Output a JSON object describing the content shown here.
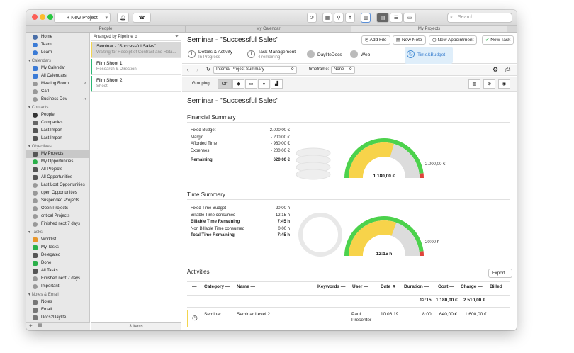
{
  "toolbar": {
    "new_project_label": "+ New Project",
    "search_placeholder": "Search"
  },
  "tabs": [
    "People",
    "My Calendar",
    "My Projects"
  ],
  "sidebar": {
    "top_items": [
      {
        "label": "Home",
        "icon": "home-icon"
      },
      {
        "label": "Team",
        "icon": "team-icon"
      },
      {
        "label": "Learn",
        "icon": "learn-icon"
      }
    ],
    "calendars_title": "Calendars",
    "calendars": [
      {
        "label": "My Calendar",
        "icon": "calendar-icon"
      },
      {
        "label": "All Calendars",
        "icon": "calendar-icon"
      },
      {
        "label": "Meeting Room",
        "icon": "resource-icon"
      },
      {
        "label": "Carl",
        "icon": "resource-icon"
      },
      {
        "label": "Business Dev",
        "icon": "resource-icon"
      }
    ],
    "contacts_title": "Contacts",
    "contacts": [
      {
        "label": "People",
        "icon": "person-icon"
      },
      {
        "label": "Companies",
        "icon": "building-icon"
      },
      {
        "label": "Last Import",
        "icon": "import-icon"
      },
      {
        "label": "Last Import",
        "icon": "import-icon"
      }
    ],
    "objectives_title": "Objectives",
    "objectives": [
      {
        "label": "My Projects",
        "icon": "project-icon"
      },
      {
        "label": "My Opportunities",
        "icon": "opportunity-icon"
      },
      {
        "label": "All Projects",
        "icon": "project-icon"
      },
      {
        "label": "All Opportunities",
        "icon": "opportunity-icon"
      },
      {
        "label": "Last Lost Opportunities",
        "icon": "filter-icon"
      },
      {
        "label": "open Opportunities",
        "icon": "filter-icon"
      },
      {
        "label": "Suspended Projects",
        "icon": "filter-icon"
      },
      {
        "label": "Open Projects",
        "icon": "filter-icon"
      },
      {
        "label": "critical Projects",
        "icon": "filter-icon"
      },
      {
        "label": "Finished next 7 days",
        "icon": "filter-icon"
      }
    ],
    "tasks_title": "Tasks",
    "tasks": [
      {
        "label": "Worklist",
        "icon": "worklist-icon"
      },
      {
        "label": "My Tasks",
        "icon": "check-icon"
      },
      {
        "label": "Delegated",
        "icon": "delegate-icon"
      },
      {
        "label": "Done",
        "icon": "done-icon"
      },
      {
        "label": "All Tasks",
        "icon": "tasks-icon"
      },
      {
        "label": "Finished next 7 days",
        "icon": "filter-icon"
      },
      {
        "label": "Important!",
        "icon": "filter-icon"
      }
    ],
    "notes_title": "Notes & Email",
    "notes": [
      {
        "label": "Notes",
        "icon": "note-icon"
      },
      {
        "label": "Email",
        "icon": "email-icon"
      },
      {
        "label": "Docs2Daylite",
        "icon": "docs-icon"
      }
    ]
  },
  "list": {
    "header": "Arranged by Pipeline ≎",
    "items": [
      {
        "title": "Seminar - \"Successful Sales\"",
        "subtitle": "Waiting for Receipt of Contract and Reta..."
      },
      {
        "title": "Film Shoot 1",
        "subtitle": "Research & Direction"
      },
      {
        "title": "Film Shoot 2",
        "subtitle": "Shoot"
      }
    ],
    "footer": "3 items"
  },
  "main": {
    "title": "Seminar - \"Successful Sales\"",
    "buttons": {
      "add_file": "Add File",
      "new_note": "New Note",
      "new_appointment": "New Appointment",
      "new_task": "New Task",
      "more": "•••"
    },
    "subtabs": [
      {
        "title": "Details & Activity",
        "subtitle": "In Progress"
      },
      {
        "title": "Task Management",
        "subtitle": "4 remaining"
      },
      {
        "title": "DayliteDocs",
        "subtitle": ""
      },
      {
        "title": "Web",
        "subtitle": ""
      },
      {
        "title": "Time&Budget",
        "subtitle": ""
      }
    ],
    "nav": {
      "view_select": "Internal Project Summary",
      "timeframe_label": "timeframe:",
      "timeframe_value": "None"
    },
    "grouping": {
      "label": "Grouping:",
      "off_label": "Off"
    },
    "report_title": "Seminar - \"Successful Sales\"",
    "financial": {
      "title": "Financial Summary",
      "rows": [
        {
          "k": "Fixed Budget",
          "v": "2.000,00 €",
          "bold": false
        },
        {
          "k": "Margin",
          "v": "- 200,00 €",
          "bold": false
        },
        {
          "k": "Afforded Time",
          "v": "- 980,00 €",
          "bold": false
        },
        {
          "k": "Expenses",
          "v": "- 200,00 €",
          "bold": false
        },
        {
          "k": "Remaining",
          "v": "620,00 €",
          "bold": true
        }
      ],
      "gauge_value_label": "1.180,00 €",
      "gauge_max_label": "2.000,00 €",
      "gauge_fraction": 0.59
    },
    "time": {
      "title": "Time Summary",
      "rows": [
        {
          "k": "Fixed Time Budget",
          "v": "20:00 h",
          "bold": false
        },
        {
          "k": "Billable Time consumed",
          "v": "12:15 h",
          "bold": false
        },
        {
          "k": "Billable Time Remaining",
          "v": "7:45 h",
          "bold": true
        },
        {
          "k": "Non Billable Time consumed",
          "v": "0:00 h",
          "bold": false
        },
        {
          "k": "Total Time Remaining",
          "v": "7:45 h",
          "bold": true
        }
      ],
      "gauge_value_label": "12:15 h",
      "gauge_max_label": "20:00 h",
      "gauge_fraction": 0.6125
    },
    "activities": {
      "title": "Activities",
      "export_label": "Export...",
      "columns": [
        "Category",
        "Name",
        "Keywords",
        "User",
        "Date",
        "Duration",
        "Cost",
        "Charge",
        "Billed"
      ],
      "totals": {
        "duration": "12:15",
        "cost": "1.180,00 €",
        "charge": "2.510,00 €"
      },
      "rows": [
        {
          "category": "Seminar",
          "name": "Seminar Level 2",
          "user": "Paul Presenter",
          "date": "10.06.19",
          "duration": "8:00",
          "cost": "640,00 €",
          "charge": "1.600,00 €"
        }
      ]
    }
  }
}
